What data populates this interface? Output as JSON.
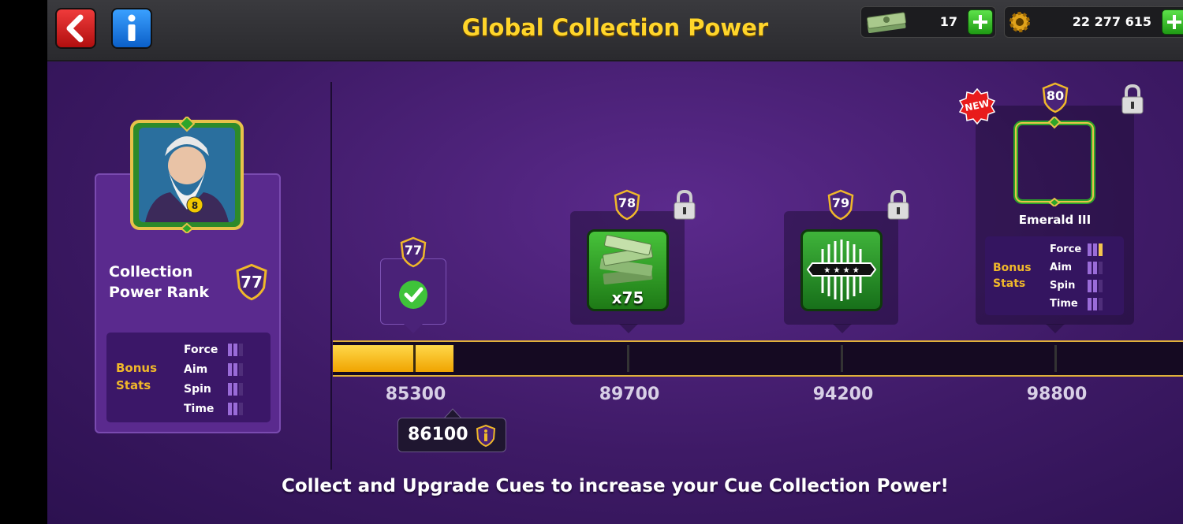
{
  "topbar": {
    "title": "Global Collection Power",
    "cash_value": "17",
    "coins_value": "22 277 615"
  },
  "rank_panel": {
    "label_line1": "Collection",
    "label_line2": "Power Rank",
    "rank": "77",
    "bonus_label_line1": "Bonus",
    "bonus_label_line2": "Stats",
    "stats": [
      "Force",
      "Aim",
      "Spin",
      "Time"
    ]
  },
  "progress": {
    "current_value": "86100",
    "fill_fraction": 0.021
  },
  "milestones": [
    {
      "level": "77",
      "points": "85300",
      "status": "completed"
    },
    {
      "level": "78",
      "points": "89700",
      "reward": "x75",
      "status": "locked"
    },
    {
      "level": "79",
      "points": "94200",
      "status": "locked"
    },
    {
      "level": "80",
      "points": "98800",
      "reward_name": "Emerald III",
      "badge": "NEW",
      "status": "locked",
      "bonus_label_line1": "Bonus",
      "bonus_label_line2": "Stats",
      "stats": [
        "Force",
        "Aim",
        "Spin",
        "Time"
      ]
    }
  ],
  "footer_text": "Collect and Upgrade Cues to increase your Cue Collection Power!",
  "colors": {
    "accent_gold": "#ffd52a",
    "bar_fill": "#f7b400",
    "panel": "#5a2a8e"
  }
}
